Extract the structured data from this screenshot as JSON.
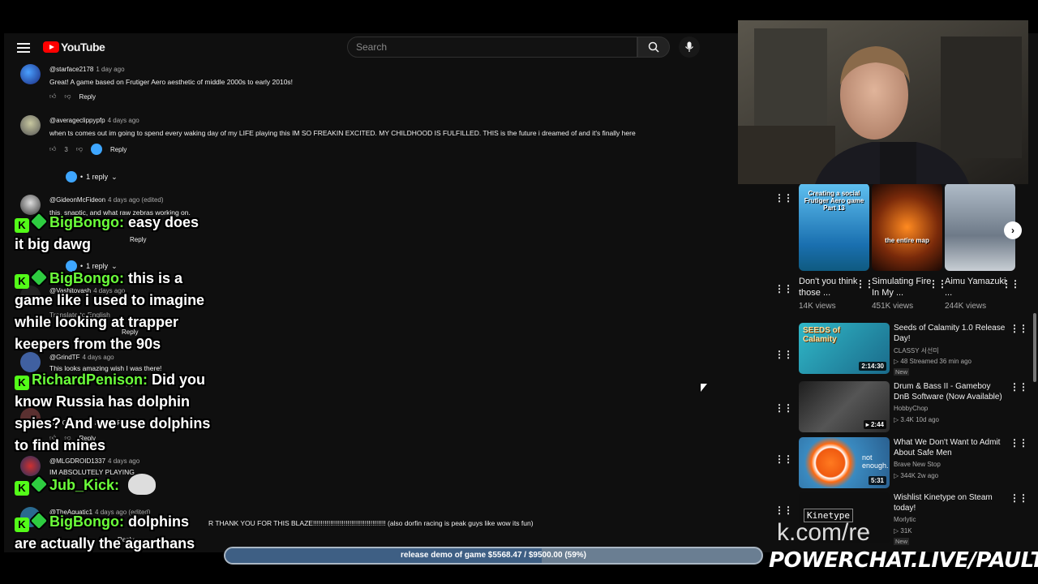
{
  "search": {
    "placeholder": "Search"
  },
  "logo": "YouTube",
  "comments": [
    {
      "author": "@starface2178",
      "time": "1 day ago",
      "text": "Great! A game based on Frutiger Aero aesthetic of middle 2000s to early 2010s!",
      "likes": "",
      "reply": "Reply"
    },
    {
      "author": "@averageclippypfp",
      "time": "4 days ago",
      "text": "when ts comes out im going to spend every waking day of my LIFE playing this IM SO FREAKIN EXCITED. MY CHILDHOOD IS FULFILLED. THIS is the future i dreamed of and it's finally here",
      "likes": "3",
      "reply": "Reply",
      "replies": "1 reply"
    },
    {
      "author": "@GideonMcFideon",
      "time": "4 days ago (edited)",
      "text": "this, snaptic, and what raw zebras working on.",
      "reply": "Reply",
      "replies": "1 reply"
    },
    {
      "author": "@Vashitovash",
      "time": "4 days ago",
      "text": "",
      "translate": "Translate to English",
      "reply": "Reply"
    },
    {
      "author": "@GrindTF",
      "time": "4 days ago",
      "text": "This looks amazing wish I was there!",
      "reply": "Reply"
    },
    {
      "author": "",
      "time": "",
      "text": "ITS GETTING BETTER!!",
      "reply": "Reply"
    },
    {
      "author": "@MLGDROID1337",
      "time": "4 days ago",
      "text": "IM ABSOLUTELY PLAYING",
      "reply": ""
    },
    {
      "author": "@TheAquatic1",
      "time": "4 days ago (edited)",
      "text": "R THANK YOU FOR THIS BLAZE!!!!!!!!!!!!!!!!!!!!!!!!!!!!!!!!!!!!!! (also dorfin racing is peak guys like wow its fun)",
      "reply": "Reply"
    }
  ],
  "shorts": [
    {
      "title": "Don't you think those ...",
      "views": "14K views",
      "overlay": "Creating a social Frutiger Aero game Part 13",
      "color": "#2a8fd0"
    },
    {
      "title": "Simulating Fire In My ...",
      "views": "451K views",
      "overlay": "the entire map",
      "color": "#5a2410"
    },
    {
      "title": "Aimu Yamazuki ...",
      "views": "244K views",
      "overlay": "",
      "color": "#8a96a4"
    }
  ],
  "videos": [
    {
      "title": "Seeds of Calamity 1.0 Release Day!",
      "channel": "CLASSY 서선미",
      "meta": "48 Streamed 36 min ago",
      "badge": "New",
      "duration": "2:14:30",
      "thumb_text": "SEEDS of Calamity",
      "color": "#1a8a9a"
    },
    {
      "title": "Drum & Bass II - Gameboy DnB Software (Now Available)",
      "channel": "HobbyChop",
      "meta": "3.4K 10d ago",
      "badge": "",
      "duration": "2:44",
      "thumb_text": "",
      "color": "#2a2a2a"
    },
    {
      "title": "What We Don't Want to Admit About Safe Men",
      "channel": "Brave New Stop",
      "meta": "344K 2w ago",
      "badge": "",
      "duration": "5:31",
      "thumb_text": "not enough.",
      "color": "#3a8ac0"
    },
    {
      "title": "Wishlist Kinetype on Steam today!",
      "channel": "Morlytic",
      "meta": "31K",
      "badge": "New",
      "duration": "",
      "thumb_text": "Kinetype",
      "color": "#111111"
    }
  ],
  "chat": [
    {
      "user": "BigBongo:",
      "lines": [
        "easy does",
        "it big dawg"
      ]
    },
    {
      "user": "BigBongo:",
      "lines": [
        "this is a",
        "game like i used to imagine",
        "while looking at trapper",
        "keepers from the 90s"
      ]
    },
    {
      "user": "RichardPenison:",
      "lines": [
        "Did you",
        "know Russia has dolphin",
        "spies? And we use dolphins",
        "to find mines"
      ]
    },
    {
      "user": "Jub_Kick:",
      "lines": [
        ""
      ]
    },
    {
      "user": "BigBongo:",
      "lines": [
        "dolphins",
        "are actually the agarthans"
      ]
    }
  ],
  "goal": {
    "label": "release demo of game $5568.47 / $9500.00 (59%)",
    "progress": 0.59
  },
  "brand": "POWERCHAT.LIVE/PAULTOWN",
  "brand_ghost": "k.com/re",
  "colors": {
    "youtube_red": "#ff0000",
    "kick_green": "#53fc18",
    "chat_name": "#6bff3a",
    "goal_fill": "#3e5f84"
  }
}
